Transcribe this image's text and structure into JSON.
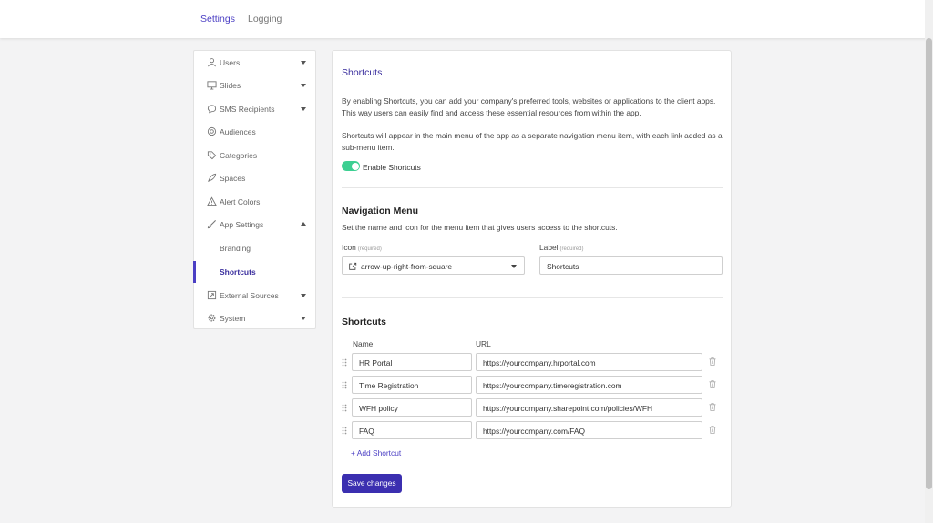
{
  "topnav": {
    "tabs": [
      "Settings",
      "Logging"
    ]
  },
  "sidebar": {
    "items": [
      {
        "label": "Users",
        "icon": "user-icon",
        "chevron": "down"
      },
      {
        "label": "Slides",
        "icon": "monitor-icon",
        "chevron": "down"
      },
      {
        "label": "SMS Recipients",
        "icon": "chat-icon",
        "chevron": "down"
      },
      {
        "label": "Audiences",
        "icon": "target-icon"
      },
      {
        "label": "Categories",
        "icon": "tag-icon"
      },
      {
        "label": "Spaces",
        "icon": "rocket-icon"
      },
      {
        "label": "Alert Colors",
        "icon": "alert-triangle-icon"
      },
      {
        "label": "App Settings",
        "icon": "brush-icon",
        "chevron": "up"
      },
      {
        "label": "Branding"
      },
      {
        "label": "Shortcuts",
        "active": true
      },
      {
        "label": "External Sources",
        "icon": "external-box-icon",
        "chevron": "down"
      },
      {
        "label": "System",
        "icon": "gear-icon",
        "chevron": "down"
      }
    ]
  },
  "main": {
    "title": "Shortcuts",
    "paragraph1": "By enabling Shortcuts, you can add your company's preferred tools, websites or applications to the client apps. This way users can easily find and access these essential resources from within the app.",
    "paragraph2": "Shortcuts will appear in the main menu of the app as a separate navigation menu item, with each link added as a sub-menu item.",
    "toggle_label": "Enable Shortcuts",
    "toggle_on": true,
    "nav_menu": {
      "title": "Navigation Menu",
      "description": "Set the name and icon for the menu item that gives users access to the shortcuts.",
      "icon_label": "Icon",
      "icon_required": "(required)",
      "icon_value": "arrow-up-right-from-square",
      "label_label": "Label",
      "label_required": "(required)",
      "label_value": "Shortcuts"
    },
    "shortcuts": {
      "title": "Shortcuts",
      "col_name": "Name",
      "col_url": "URL",
      "rows": [
        {
          "name": "HR Portal",
          "url": "https://yourcompany.hrportal.com"
        },
        {
          "name": "Time Registration",
          "url": "https://yourcompany.timeregistration.com"
        },
        {
          "name": "WFH policy",
          "url": "https://yourcompany.sharepoint.com/policies/WFH"
        },
        {
          "name": "FAQ",
          "url": "https://yourcompany.com/FAQ"
        }
      ],
      "add_label": "+ Add Shortcut"
    },
    "save_label": "Save changes"
  },
  "colors": {
    "accent": "#4b3fc4",
    "toggle": "#3dcf92",
    "button": "#3b2fb0"
  }
}
